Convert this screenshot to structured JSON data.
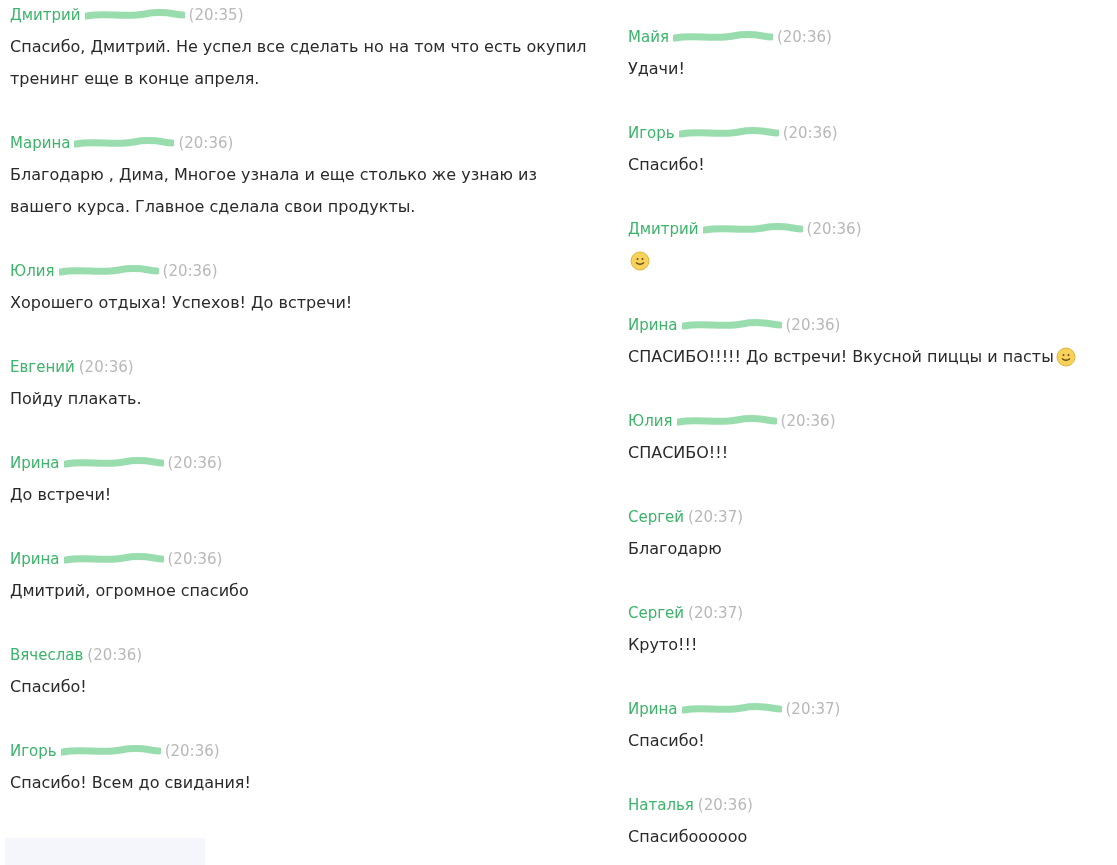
{
  "columns": [
    {
      "messages": [
        {
          "author": "Дмитрий",
          "redacted": true,
          "time": "(20:35)",
          "text": "Спасибо, Дмитрий. Не успел все сделать но на том что есть окупил тренинг еще в конце апреля.",
          "smiley": false
        },
        {
          "author": "Марина",
          "redacted": true,
          "time": "(20:36)",
          "text": "Благодарю , Дима, Многое узнала и еще  столько же узнаю из вашего курса. Главное сделала свои продукты.",
          "smiley": false
        },
        {
          "author": "Юлия",
          "redacted": true,
          "time": "(20:36)",
          "text": "Хорошего отдыха! Успехов! До встречи!",
          "smiley": false
        },
        {
          "author": "Евгений",
          "redacted": false,
          "time": "(20:36)",
          "text": "Пойду плакать.",
          "smiley": false
        },
        {
          "author": "Ирина",
          "redacted": true,
          "time": "(20:36)",
          "text": "До встречи!",
          "smiley": false
        },
        {
          "author": "Ирина",
          "redacted": true,
          "time": "(20:36)",
          "text": "Дмитрий, огромное спасибо",
          "smiley": false
        },
        {
          "author": "Вячеслав",
          "redacted": false,
          "time": "(20:36)",
          "text": "Спасибо!",
          "smiley": false
        },
        {
          "author": "Игорь",
          "redacted": true,
          "time": "(20:36)",
          "text": "Спасибо! Всем до свидания!",
          "smiley": false
        }
      ],
      "input": {
        "kind": "input"
      }
    },
    {
      "messages": [
        {
          "author": "Майя",
          "redacted": true,
          "time": "(20:36)",
          "text": "Удачи!",
          "smiley": false
        },
        {
          "author": "Игорь",
          "redacted": true,
          "time": "(20:36)",
          "text": "Спасибо!",
          "smiley": false
        },
        {
          "author": "Дмитрий",
          "redacted": true,
          "time": "(20:36)",
          "smiley": true
        },
        {
          "author": "Ирина",
          "redacted": true,
          "time": "(20:36)",
          "text": "СПАСИБО!!!!! До встречи! Вкусной пиццы и пасты",
          "smiley": true
        },
        {
          "author": "Юлия",
          "redacted": true,
          "time": "(20:36)",
          "text": "СПАСИБО!!!",
          "smiley": false
        },
        {
          "author": "Сергей",
          "redacted": false,
          "time": "(20:37)",
          "text": "Благодарю",
          "smiley": false
        },
        {
          "author": "Сергей",
          "redacted": false,
          "time": "(20:37)",
          "text": "Круто!!!",
          "smiley": false
        },
        {
          "author": "Ирина",
          "redacted": true,
          "time": "(20:37)",
          "text": "Спасибо!",
          "smiley": false
        },
        {
          "author": "Наталья",
          "redacted": false,
          "time": "(20:36)",
          "text": "Спасибоооооо",
          "smiley": false
        }
      ]
    }
  ]
}
